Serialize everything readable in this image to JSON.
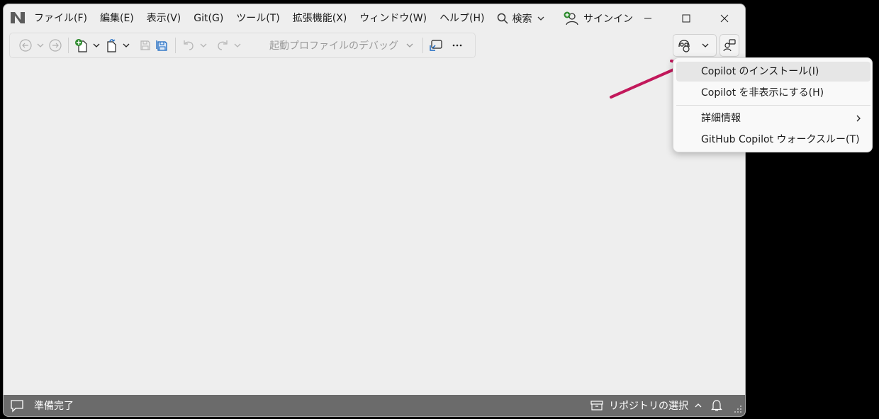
{
  "menu": {
    "items": [
      "ファイル(F)",
      "編集(E)",
      "表示(V)",
      "Git(G)",
      "ツール(T)",
      "拡張機能(X)",
      "ウィンドウ(W)",
      "ヘルプ(H)"
    ],
    "search_label": "検索"
  },
  "account": {
    "signin_label": "サインイン"
  },
  "toolbar": {
    "startup_label": "起動プロファイルのデバッグ"
  },
  "dropdown": {
    "items": [
      {
        "label": "Copilot のインストール(I)"
      },
      {
        "label": "Copilot を非表示にする(H)"
      },
      {
        "label": "詳細情報"
      },
      {
        "label": "GitHub Copilot ウォークスルー(T)"
      }
    ]
  },
  "statusbar": {
    "ready_label": "準備完了",
    "repo_label": "リポジトリの選択"
  },
  "colors": {
    "annotation_arrow": "#c2185b",
    "statusbar_bg": "#6b6b6b",
    "add_green": "#2e8b2e",
    "save_blue": "#1565c0"
  }
}
